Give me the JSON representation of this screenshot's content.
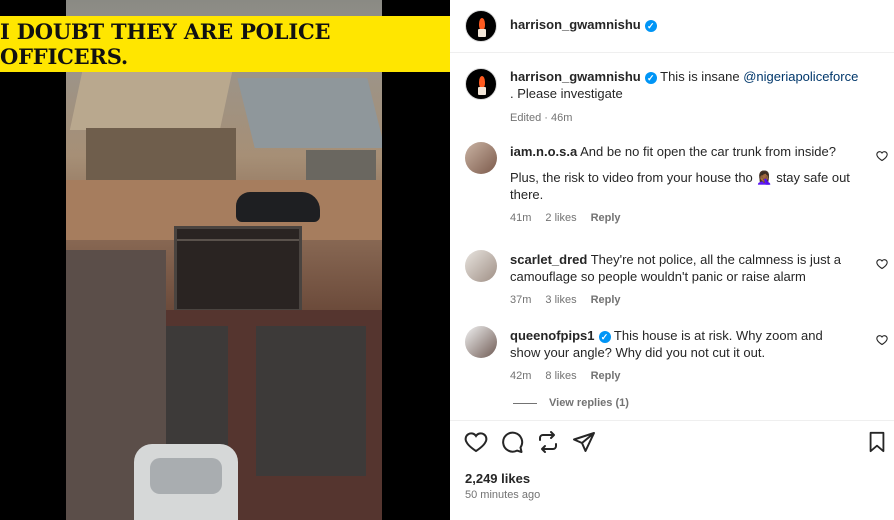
{
  "media": {
    "banner_text": "I DOUBT THEY ARE POLICE OFFICERS."
  },
  "header": {
    "username": "harrison_gwamnishu",
    "verified_glyph": "✓"
  },
  "caption": {
    "username": "harrison_gwamnishu",
    "text_before": "This is insane ",
    "mention": "@nigeriapoliceforce",
    "text_after": " . Please investigate",
    "status": "Edited · 46m"
  },
  "comments": [
    {
      "username": "iam.n.o.s.a",
      "text": "And be no fit open the car trunk from inside?",
      "text2": "Plus, the risk to video from your house tho 🤦🏾‍♀️ stay safe out there.",
      "time": "41m",
      "likes": "2 likes",
      "reply": "Reply"
    },
    {
      "username": "scarlet_dred",
      "text": "They're not police, all the calmness is just a camouflage so people wouldn't panic or raise alarm",
      "time": "37m",
      "likes": "3 likes",
      "reply": "Reply"
    },
    {
      "username": "queenofpips1",
      "text": "This house is at risk. Why zoom and show your angle? Why did you not cut it out.",
      "time": "42m",
      "likes": "8 likes",
      "reply": "Reply"
    }
  ],
  "view_replies": "View replies (1)",
  "actions": {
    "like_icon": "heart-icon",
    "comment_icon": "comment-icon",
    "repost_icon": "repost-icon",
    "share_icon": "share-icon",
    "save_icon": "bookmark-icon"
  },
  "stats": {
    "likes": "2,249 likes",
    "posted": "50 minutes ago"
  },
  "colors": {
    "banner": "#ffe600",
    "verified": "#0095f6",
    "mention": "#00376b"
  }
}
